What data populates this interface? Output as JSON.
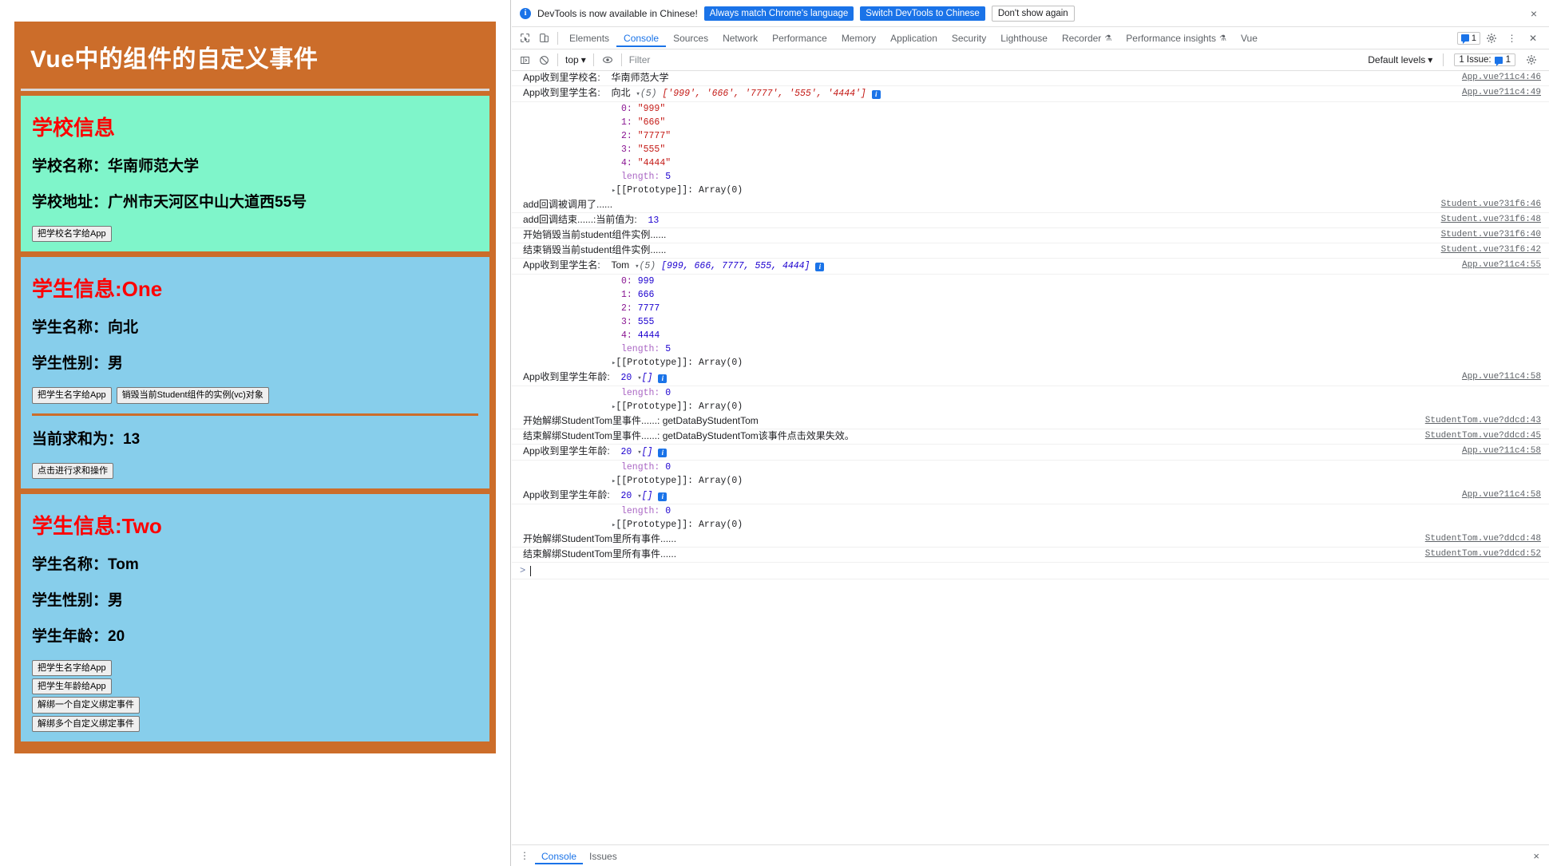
{
  "app": {
    "title": "Vue中的组件的自定义事件",
    "school": {
      "heading": "学校信息",
      "name_label": "学校名称：",
      "name_value": "华南师范大学",
      "addr_label": "学校地址：",
      "addr_value": "广州市天河区中山大道西55号",
      "button": "把学校名字给App"
    },
    "student_one": {
      "heading": "学生信息:One",
      "name_label": "学生名称：",
      "name_value": "向北",
      "sex_label": "学生性别：",
      "sex_value": "男",
      "btn_give_name": "把学生名字给App",
      "btn_destroy": "销毁当前Student组件的实例(vc)对象",
      "sum_label": "当前求和为：",
      "sum_value": "13",
      "btn_sum": "点击进行求和操作"
    },
    "student_two": {
      "heading": "学生信息:Two",
      "name_label": "学生名称：",
      "name_value": "Tom",
      "sex_label": "学生性别：",
      "sex_value": "男",
      "age_label": "学生年龄：",
      "age_value": "20",
      "btn_give_name": "把学生名字给App",
      "btn_give_age": "把学生年龄给App",
      "btn_unbind_one": "解绑一个自定义绑定事件",
      "btn_unbind_many": "解绑多个自定义绑定事件"
    },
    "colors": {
      "app_bg": "#cc6d2a",
      "school_bg": "#7ff5ca",
      "student_bg": "#87ceeb",
      "heading": "#ff0000",
      "title": "#ffffff"
    }
  },
  "devtools": {
    "banner": {
      "icon": "info-icon",
      "text": "DevTools is now available in Chinese!",
      "btn_always": "Always match Chrome's language",
      "btn_switch": "Switch DevTools to Chinese",
      "btn_dismiss": "Don't show again",
      "close": "×"
    },
    "tabs": [
      {
        "label": "Elements",
        "active": false,
        "warn": false
      },
      {
        "label": "Console",
        "active": true,
        "warn": false
      },
      {
        "label": "Sources",
        "active": false,
        "warn": false
      },
      {
        "label": "Network",
        "active": false,
        "warn": false
      },
      {
        "label": "Performance",
        "active": false,
        "warn": false
      },
      {
        "label": "Memory",
        "active": false,
        "warn": false
      },
      {
        "label": "Application",
        "active": false,
        "warn": false
      },
      {
        "label": "Security",
        "active": false,
        "warn": false
      },
      {
        "label": "Lighthouse",
        "active": false,
        "warn": false
      },
      {
        "label": "Recorder",
        "active": false,
        "warn": true
      },
      {
        "label": "Performance insights",
        "active": false,
        "warn": true
      },
      {
        "label": "Vue",
        "active": false,
        "warn": false
      }
    ],
    "tab_badge_count": "1",
    "toolbar": {
      "context": "top",
      "filter_placeholder": "Filter",
      "filter_value": "",
      "levels": "Default levels",
      "issues": "1 Issue:",
      "issues_count": "1"
    },
    "drawer": {
      "tabs": [
        {
          "label": "Console",
          "active": true
        },
        {
          "label": "Issues",
          "active": false
        }
      ],
      "close": "×"
    },
    "logs": [
      {
        "kind": "kv",
        "cn": "App收到里学校名:",
        "val": "华南师范大学",
        "src": "App.vue?11c4:46"
      },
      {
        "kind": "array-head-str",
        "cn": "App收到里学生名:",
        "val": "向北",
        "count": "(5)",
        "preview": "['999', '666', '7777', '555', '4444']",
        "src": "App.vue?11c4:49"
      },
      {
        "kind": "idx-str",
        "idx": "0",
        "val": "\"999\"",
        "src": ""
      },
      {
        "kind": "idx-str",
        "idx": "1",
        "val": "\"666\"",
        "src": ""
      },
      {
        "kind": "idx-str",
        "idx": "2",
        "val": "\"7777\"",
        "src": ""
      },
      {
        "kind": "idx-str",
        "idx": "3",
        "val": "\"555\"",
        "src": ""
      },
      {
        "kind": "idx-str",
        "idx": "4",
        "val": "\"4444\"",
        "src": ""
      },
      {
        "kind": "len",
        "label": "length:",
        "val": "5",
        "src": ""
      },
      {
        "kind": "proto",
        "text": "[[Prototype]]: Array(0)",
        "src": ""
      },
      {
        "kind": "plain",
        "cn": "add回调被调用了......",
        "src": "Student.vue?31f6:46"
      },
      {
        "kind": "kv-num",
        "cn": "add回调结束......:当前值为:",
        "val": "13",
        "src": "Student.vue?31f6:48"
      },
      {
        "kind": "plain",
        "cn": "开始销毁当前student组件实例......",
        "src": "Student.vue?31f6:40"
      },
      {
        "kind": "plain",
        "cn": "结束销毁当前student组件实例......",
        "src": "Student.vue?31f6:42"
      },
      {
        "kind": "array-head-num",
        "cn": "App收到里学生名:",
        "val": "Tom",
        "count": "(5)",
        "preview": "[999, 666, 7777, 555, 4444]",
        "src": "App.vue?11c4:55"
      },
      {
        "kind": "idx-num",
        "idx": "0",
        "val": "999",
        "src": ""
      },
      {
        "kind": "idx-num",
        "idx": "1",
        "val": "666",
        "src": ""
      },
      {
        "kind": "idx-num",
        "idx": "2",
        "val": "7777",
        "src": ""
      },
      {
        "kind": "idx-num",
        "idx": "3",
        "val": "555",
        "src": ""
      },
      {
        "kind": "idx-num",
        "idx": "4",
        "val": "4444",
        "src": ""
      },
      {
        "kind": "len",
        "label": "length:",
        "val": "5",
        "src": ""
      },
      {
        "kind": "proto",
        "text": "[[Prototype]]: Array(0)",
        "src": ""
      },
      {
        "kind": "array-empty",
        "cn": "App收到里学生年龄:",
        "val": "20",
        "preview": "[]",
        "src": "App.vue?11c4:58"
      },
      {
        "kind": "len",
        "label": "length:",
        "val": "0",
        "src": ""
      },
      {
        "kind": "proto",
        "text": "[[Prototype]]: Array(0)",
        "src": ""
      },
      {
        "kind": "plain",
        "cn": "开始解绑StudentTom里事件......: getDataByStudentTom",
        "src": "StudentTom.vue?ddcd:43"
      },
      {
        "kind": "plain",
        "cn": "结束解绑StudentTom里事件......: getDataByStudentTom该事件点击效果失效。",
        "src": "StudentTom.vue?ddcd:45"
      },
      {
        "kind": "array-empty",
        "cn": "App收到里学生年龄:",
        "val": "20",
        "preview": "[]",
        "src": "App.vue?11c4:58"
      },
      {
        "kind": "len",
        "label": "length:",
        "val": "0",
        "src": ""
      },
      {
        "kind": "proto",
        "text": "[[Prototype]]: Array(0)",
        "src": ""
      },
      {
        "kind": "array-empty",
        "cn": "App收到里学生年龄:",
        "val": "20",
        "preview": "[]",
        "src": "App.vue?11c4:58"
      },
      {
        "kind": "len",
        "label": "length:",
        "val": "0",
        "src": ""
      },
      {
        "kind": "proto",
        "text": "[[Prototype]]: Array(0)",
        "src": ""
      },
      {
        "kind": "plain",
        "cn": "开始解绑StudentTom里所有事件......",
        "src": "StudentTom.vue?ddcd:48"
      },
      {
        "kind": "plain",
        "cn": "结束解绑StudentTom里所有事件......",
        "src": "StudentTom.vue?ddcd:52"
      }
    ]
  }
}
